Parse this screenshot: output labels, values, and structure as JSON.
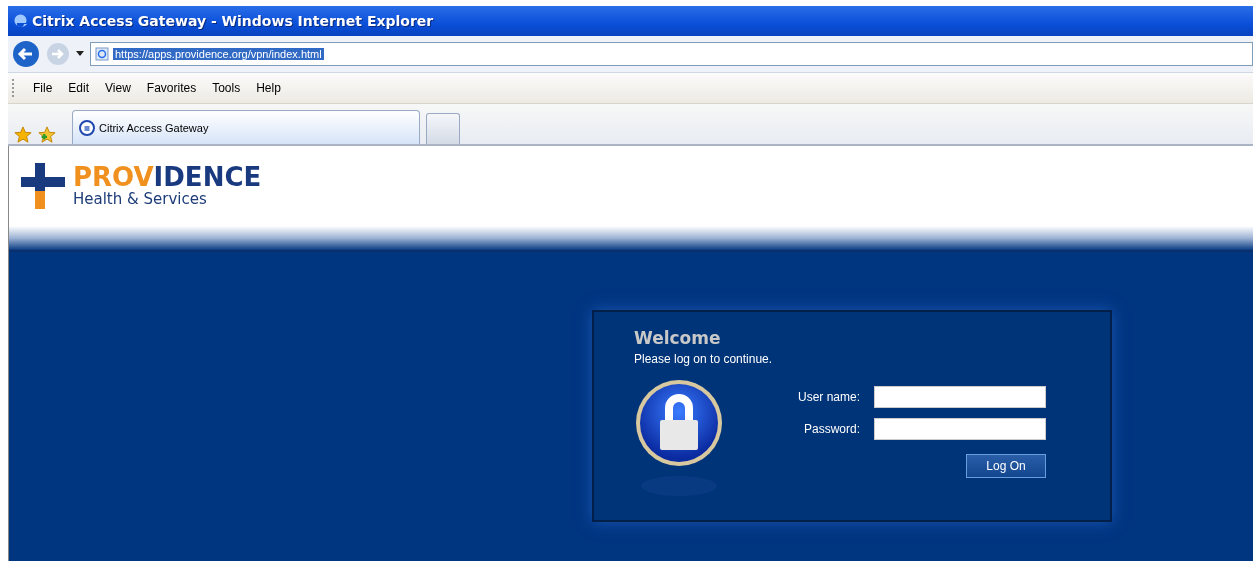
{
  "window": {
    "title": "Citrix Access Gateway - Windows Internet Explorer"
  },
  "address_bar": {
    "url": "https://apps.providence.org/vpn/index.html",
    "selected": true
  },
  "menu": [
    "File",
    "Edit",
    "View",
    "Favorites",
    "Tools",
    "Help"
  ],
  "tabs": [
    {
      "label": "Citrix Access Gateway",
      "selected": true
    }
  ],
  "logo": {
    "name_parts": [
      "PROV",
      "IDENCE"
    ],
    "tagline": "Health & Services"
  },
  "login": {
    "title": "Welcome",
    "subtitle": "Please log on to continue.",
    "fields": [
      {
        "label": "User name:"
      },
      {
        "label": "Password:"
      }
    ],
    "button": "Log On"
  }
}
